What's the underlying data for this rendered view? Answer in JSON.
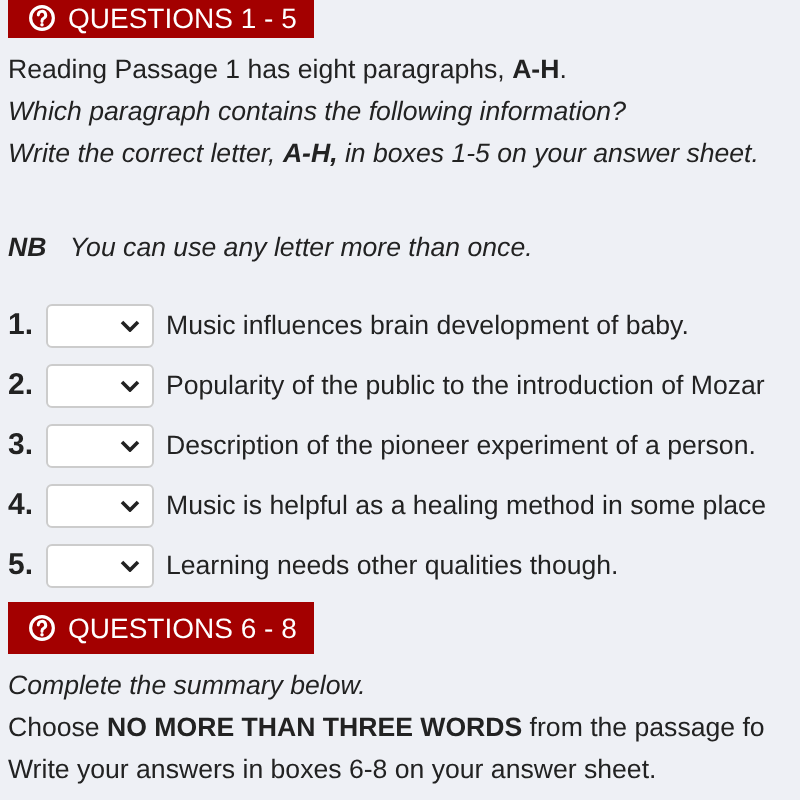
{
  "sections": [
    {
      "kind": "matching",
      "header": "QUESTIONS 1 - 5",
      "instructions": [
        {
          "kind": "statement",
          "text": "Reading Passage 1 has eight paragraphs, **A-H**."
        },
        {
          "kind": "instruction",
          "text": "Which paragraph contains the following information?"
        },
        {
          "kind": "instruction",
          "text": "Write the correct letter, **A-H,** in boxes 1-5 on your answer sheet."
        }
      ],
      "note": {
        "label": "NB",
        "text": "You can use any letter more than once."
      },
      "questions": [
        {
          "number": "1.",
          "text": "Music influences brain development of baby."
        },
        {
          "number": "2.",
          "text": "Popularity of the public to the introduction of Mozar"
        },
        {
          "number": "3.",
          "text": "Description of the pioneer experiment of a person."
        },
        {
          "number": "4.",
          "text": "Music is helpful as a healing method in some place"
        },
        {
          "number": "5.",
          "text": "Learning needs other qualities though."
        }
      ]
    },
    {
      "kind": "summary",
      "header": "QUESTIONS 6 - 8",
      "instructions": [
        {
          "kind": "instruction",
          "text": "Complete the summary below."
        },
        {
          "kind": "statement",
          "text": "Choose **NO MORE THAN THREE WORDS** from the passage fo"
        },
        {
          "kind": "statement",
          "text": "Write your answers in boxes 6-8 on your answer sheet."
        }
      ]
    }
  ]
}
